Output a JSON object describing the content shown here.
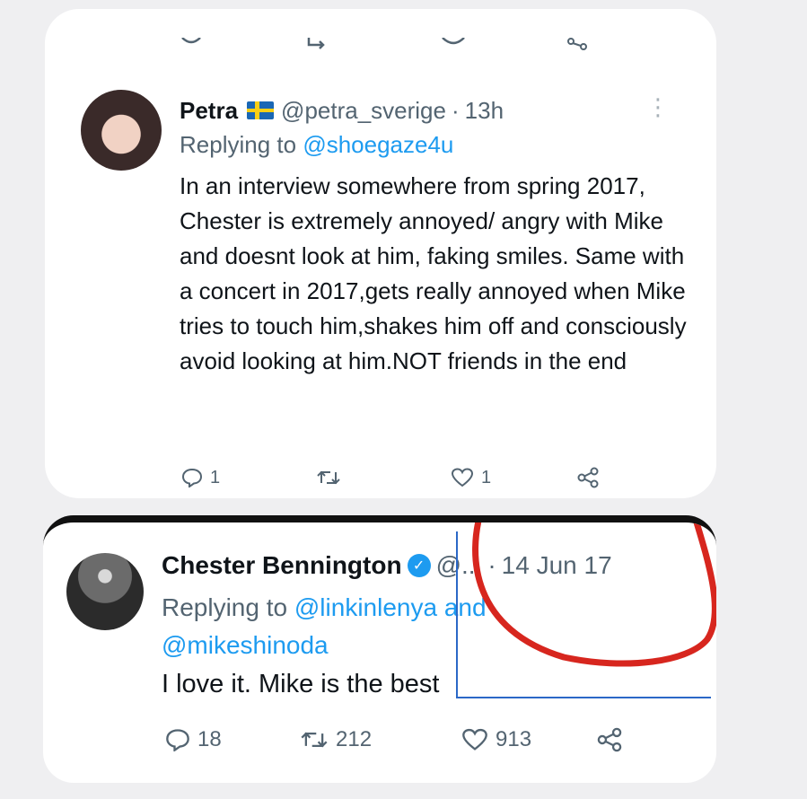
{
  "tweet1": {
    "name": "Petra",
    "flag_icon": "sweden-flag-icon",
    "handle": "@petra_sverige",
    "separator": "·",
    "time": "13h",
    "more": "⋮",
    "replying_prefix": "Replying to",
    "replying_to": "@shoegaze4u",
    "text": "In an interview somewhere from spring 2017, Chester is extremely annoyed/ angry with Mike and doesnt look at him, faking smiles. Same with a concert in 2017,gets really annoyed when Mike tries to touch him,shakes him off and consciously avoid looking at him.NOT friends in the  end",
    "actions": {
      "reply_count": "1",
      "retweet_count": "",
      "like_count": "1"
    }
  },
  "tweet2": {
    "name": "Chester Bennington",
    "verified_icon": "verified-badge-icon",
    "handle": "@...",
    "separator": "·",
    "time": "14 Jun 17",
    "replying_prefix": "Replying to",
    "replying_to_1": "@linkinlenya",
    "replying_and": "and",
    "replying_to_2": "@mikeshinoda",
    "text": "I love it. Mike is the best",
    "actions": {
      "reply_count": "18",
      "retweet_count": "212",
      "like_count": "913"
    }
  },
  "colors": {
    "link": "#1d9bf0",
    "muted": "#536471",
    "annotation_red": "#d7261e",
    "annotation_blue": "#2b68c7"
  }
}
